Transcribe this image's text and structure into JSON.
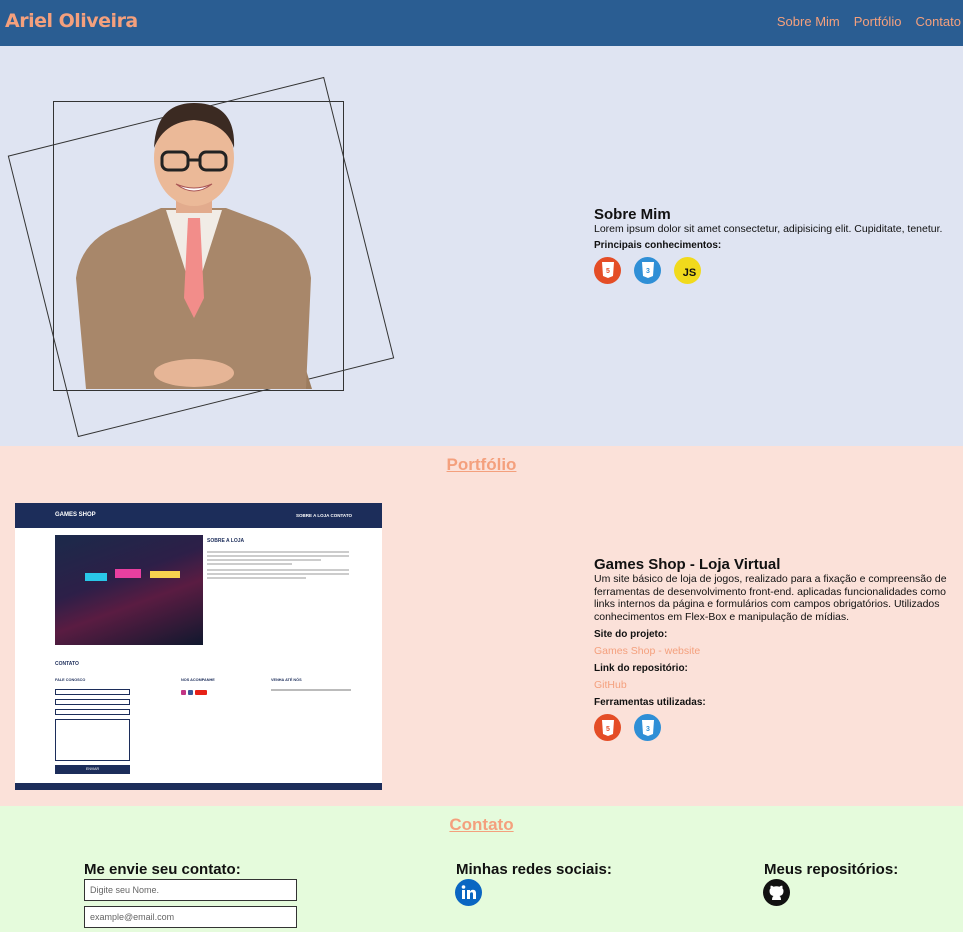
{
  "header": {
    "brand": "Ariel Oliveira",
    "nav": [
      "Sobre Mim",
      "Portfólio",
      "Contato"
    ]
  },
  "about": {
    "title": "Sobre Mim",
    "text": "Lorem ipsum dolor sit amet consectetur, adipisicing elit. Cupiditate, tenetur.",
    "skills_label": "Principais conhecimentos:",
    "skills": [
      {
        "icon": "html5-icon",
        "label": "HTML"
      },
      {
        "icon": "css3-icon",
        "label": "CSS"
      },
      {
        "icon": "javascript-icon",
        "label": "JS"
      }
    ]
  },
  "portfolio": {
    "section_title": "Portfólio",
    "project_title": "Games Shop - Loja Virtual",
    "description": "Um site básico de loja de jogos, realizado para a fixação e compreensão de ferramentas de desenvolvimento front-end. aplicadas funcionalidades como links internos da página e formulários com campos obrigatórios. Utilizados conhecimentos em Flex-Box e manipulação de mídias.",
    "site_label": "Site do projeto:",
    "site_link": "Games Shop - website",
    "repo_label": "Link do repositório:",
    "repo_link": "GitHub",
    "tools_label": "Ferramentas utilizadas:",
    "tools": [
      "html5-icon",
      "css3-icon"
    ],
    "preview": {
      "brand": "GAMES SHOP",
      "links": "SOBRE A LOJA    CONTATO",
      "heading": "SOBRE A LOJA",
      "contact_heading": "CONTATO",
      "col1": "FALE CONOSCO",
      "col2": "NOS ACOMPANHE",
      "col3": "VENHA ATÉ NÓS",
      "button": "ENVIAR"
    }
  },
  "contact": {
    "section_title": "Contato",
    "form_title": "Me envie seu contato:",
    "name_placeholder": "Digite seu Nome.",
    "email_placeholder": "example@email.com",
    "social_title": "Minhas redes sociais:",
    "repos_title": "Meus repositórios:"
  },
  "colors": {
    "header": "#2a5d92",
    "accent": "#f4a07d",
    "about_bg": "#dfe4f2",
    "portfolio_bg": "#fbe1d9",
    "contact_bg": "#e5fbdc"
  }
}
